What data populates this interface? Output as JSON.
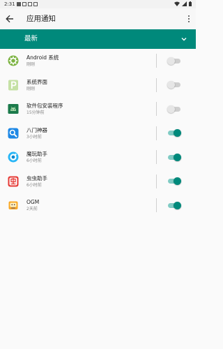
{
  "status_bar": {
    "time": "2:31"
  },
  "app_bar": {
    "title": "应用通知",
    "back_icon": "back-arrow-icon",
    "more_icon": "more-vert-icon"
  },
  "section": {
    "label": "最新",
    "icon": "chevron-down-icon",
    "color": "#00897b"
  },
  "apps": [
    {
      "name": "Android 系统",
      "time": "刚刚",
      "enabled": false,
      "icon": "android-system-icon"
    },
    {
      "name": "系统界面",
      "time": "刚刚",
      "enabled": false,
      "icon": "system-ui-icon"
    },
    {
      "name": "软件包安装程序",
      "time": "15分钟前",
      "enabled": false,
      "icon": "package-installer-icon"
    },
    {
      "name": "八门神器",
      "time": "3小时前",
      "enabled": true,
      "icon": "bamen-icon"
    },
    {
      "name": "魔玩助手",
      "time": "6小时前",
      "enabled": true,
      "icon": "mowan-icon"
    },
    {
      "name": "虫虫助手",
      "time": "6小时前",
      "enabled": true,
      "icon": "chongchong-icon"
    },
    {
      "name": "OGM",
      "time": "2天前",
      "enabled": true,
      "icon": "ogm-icon"
    }
  ]
}
